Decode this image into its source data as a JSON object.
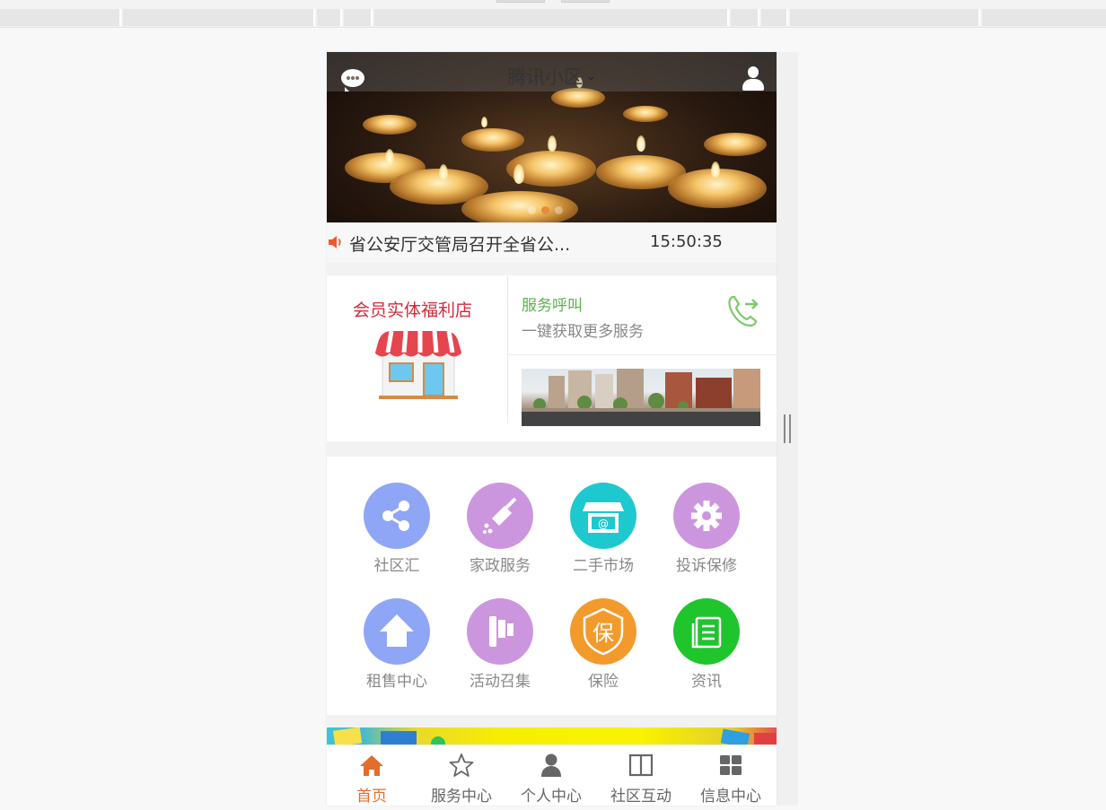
{
  "header": {
    "community_name": "腾讯小区",
    "dropdown_icon": "chevron-down-icon",
    "left_icon": "chat-bubble-icon",
    "right_icon": "user-icon"
  },
  "banner": {
    "slide_count": 3,
    "active_slide": 2
  },
  "news": {
    "icon": "speaker-icon",
    "headline": "省公安厅交管局召开全省公...",
    "time": "15:50:35"
  },
  "promo": {
    "store_title": "会员实体福利店",
    "store_icon": "storefront-icon",
    "service_title": "服务呼叫",
    "service_subtitle": "一键获取更多服务",
    "service_icon": "phone-call-icon"
  },
  "services": [
    {
      "label": "社区汇",
      "icon": "share-icon",
      "color": "#8fa6f7"
    },
    {
      "label": "家政服务",
      "icon": "broom-icon",
      "color": "#cc96de"
    },
    {
      "label": "二手市场",
      "icon": "shop-icon",
      "color": "#1dc8cf"
    },
    {
      "label": "投诉保修",
      "icon": "gear-icon",
      "color": "#cc96de"
    },
    {
      "label": "租售中心",
      "icon": "house-icon",
      "color": "#8fa6f7"
    },
    {
      "label": "活动召集",
      "icon": "flag-icon",
      "color": "#cc96de"
    },
    {
      "label": "保险",
      "icon": "shield-icon",
      "color": "#f39a2c"
    },
    {
      "label": "资讯",
      "icon": "news-icon",
      "color": "#20c52e"
    }
  ],
  "tabbar": {
    "active_color": "#e26d2c",
    "items": [
      {
        "label": "首页",
        "icon": "home-icon",
        "active": true
      },
      {
        "label": "服务中心",
        "icon": "star-icon",
        "active": false
      },
      {
        "label": "个人中心",
        "icon": "person-icon",
        "active": false
      },
      {
        "label": "社区互动",
        "icon": "book-icon",
        "active": false
      },
      {
        "label": "信息中心",
        "icon": "grid-icon",
        "active": false
      }
    ]
  }
}
